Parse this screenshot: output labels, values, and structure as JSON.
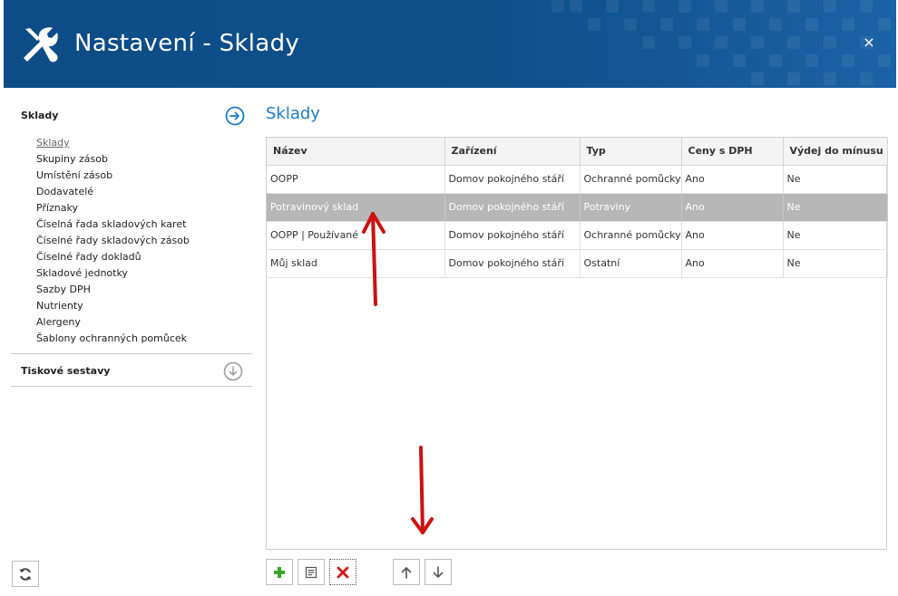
{
  "window": {
    "title": "Nastavení - Sklady",
    "close_glyph": "×"
  },
  "sidebar": {
    "section1": {
      "label": "Sklady",
      "icon": "arrow-right-circle-icon"
    },
    "items": [
      {
        "label": "Sklady",
        "active": true
      },
      {
        "label": "Skupiny zásob"
      },
      {
        "label": "Umístění zásob"
      },
      {
        "label": "Dodavatelé"
      },
      {
        "label": "Příznaky"
      },
      {
        "label": "Číselná řada skladových karet"
      },
      {
        "label": "Číselné řady skladových zásob"
      },
      {
        "label": "Číselné řady dokladů"
      },
      {
        "label": "Skladové jednotky"
      },
      {
        "label": "Sazby DPH"
      },
      {
        "label": "Nutrienty"
      },
      {
        "label": "Alergeny"
      },
      {
        "label": "Šablony ochranných pomůcek"
      }
    ],
    "section2": {
      "label": "Tiskové sestavy",
      "icon": "arrow-down-circle-icon"
    }
  },
  "main": {
    "title": "Sklady",
    "columns": [
      "Název",
      "Zařízení",
      "Typ",
      "Ceny s DPH",
      "Výdej do mínusu"
    ],
    "rows": [
      [
        "OOPP",
        "Domov pokojného stáří",
        "Ochranné pomůcky",
        "Ano",
        "Ne"
      ],
      [
        "Potravinový sklad",
        "Domov pokojného stáří",
        "Potraviny",
        "Ano",
        "Ne"
      ],
      [
        "OOPP | Používané",
        "Domov pokojného stáří",
        "Ochranné pomůcky",
        "Ano",
        "Ne"
      ],
      [
        "Můj sklad",
        "Domov pokojného stáří",
        "Ostatní",
        "Ano",
        "Ne"
      ]
    ],
    "selected_row": 1
  },
  "toolbar": {
    "buttons": [
      "add-icon",
      "edit-icon",
      "delete-icon",
      "move-up-icon",
      "move-down-icon"
    ],
    "refresh_icon": "refresh-icon"
  },
  "colors": {
    "header": "#0e4f8c",
    "accent": "#1a7dc4",
    "selected_row": "#b7b7b7",
    "annotation": "#cc1111",
    "add": "#3aa52a",
    "delete": "#d11a1a"
  }
}
